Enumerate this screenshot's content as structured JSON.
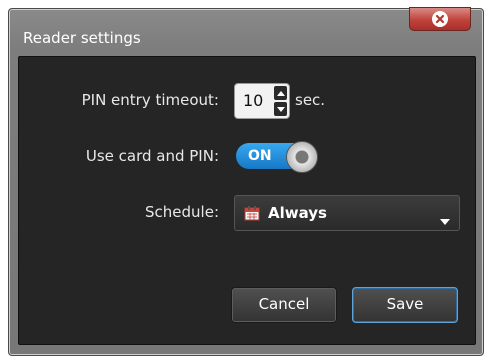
{
  "window": {
    "title": "Reader settings"
  },
  "form": {
    "pin_timeout": {
      "label": "PIN entry timeout:",
      "value": "10",
      "unit": "sec."
    },
    "card_and_pin": {
      "label": "Use card and PIN:",
      "state": "ON"
    },
    "schedule": {
      "label": "Schedule:",
      "value": "Always"
    }
  },
  "buttons": {
    "cancel": "Cancel",
    "save": "Save"
  },
  "colors": {
    "accent": "#1e88d6",
    "close": "#c0433b",
    "panel": "#252525"
  },
  "icons": {
    "close": "close-icon",
    "calendar": "calendar-icon",
    "dropdown": "chevron-down-icon"
  }
}
